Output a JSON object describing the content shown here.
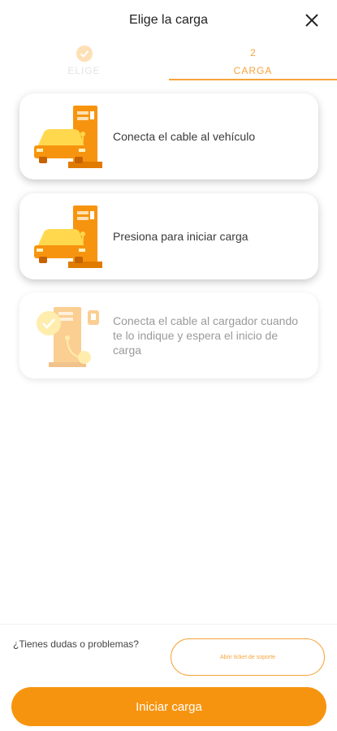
{
  "header": {
    "title": "Elige la carga",
    "close_icon": "close-icon"
  },
  "stepper": {
    "steps": [
      {
        "label": "ELIGE",
        "state": "completed",
        "icon": "check-icon"
      },
      {
        "number": "2",
        "label": "CARGA",
        "state": "active"
      }
    ]
  },
  "cards": [
    {
      "text": "Conecta el cable al vehículo",
      "icon": "car-charger-icon",
      "state": "active"
    },
    {
      "text": "Presiona para iniciar carga",
      "icon": "car-charger-icon",
      "state": "active"
    },
    {
      "text": "Conecta el cable al cargador cuando te lo indique y espera el inicio de carga",
      "icon": "charger-plug-icon",
      "state": "disabled"
    }
  ],
  "footer": {
    "help_text": "¿Tienes dudas o problemas?",
    "support_button": "Abrir ticket de soporte",
    "start_button": "Iniciar carga"
  },
  "colors": {
    "accent": "#f7940f",
    "accent_light": "#f7a43a",
    "car": "#ffd84d"
  }
}
